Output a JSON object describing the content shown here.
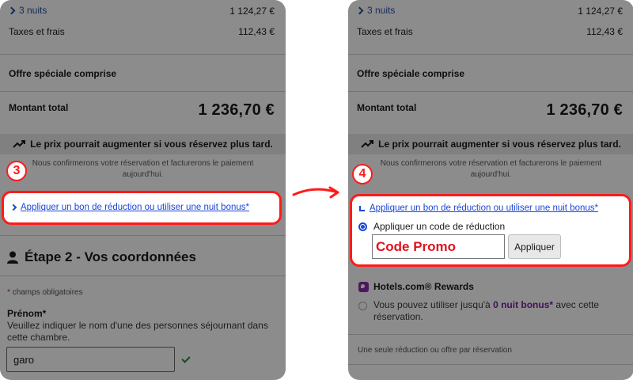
{
  "left": {
    "nights": "3 nuits",
    "nights_price": "1 124,27 €",
    "taxes_label": "Taxes et frais",
    "taxes_price": "112,43 €",
    "special_offer": "Offre spéciale comprise",
    "total_label": "Montant total",
    "total_amount": "1 236,70 €",
    "price_warning": "Le prix pourrait augmenter si vous réservez plus tard.",
    "confirm_line1": "Nous confirmerons votre réservation et facturerons le paiement",
    "confirm_line2": "aujourd'hui.",
    "badge": "3",
    "discount_link": "Appliquer un bon de réduction ou utiliser une nuit bonus*",
    "step_title": "Étape 2 - Vos coordonnées",
    "required_note": "champs obligatoires",
    "firstname_label": "Prénom*",
    "firstname_help_line1": "Veuillez indiquer le nom d'une des personnes séjournant dans",
    "firstname_help_line2": "cette chambre.",
    "firstname_value": "garo"
  },
  "right": {
    "nights": "3 nuits",
    "nights_price": "1 124,27 €",
    "taxes_label": "Taxes et frais",
    "taxes_price": "112,43 €",
    "special_offer": "Offre spéciale comprise",
    "total_label": "Montant total",
    "total_amount": "1 236,70 €",
    "price_warning": "Le prix pourrait augmenter si vous réservez plus tard.",
    "confirm_line1": "Nous confirmerons votre réservation et facturerons le paiement",
    "confirm_line2": "aujourd'hui.",
    "badge": "4",
    "discount_link": "Appliquer un bon de réduction ou utiliser une nuit bonus*",
    "code_option": "Appliquer un code de réduction",
    "promo_value": "Code Promo",
    "apply_button": "Appliquer",
    "rewards_title": "Hotels.com® Rewards",
    "rewards_text_part1": "Vous pouvez utiliser jusqu'à ",
    "rewards_text_bold": "0 nuit bonus*",
    "rewards_text_part2": " avec cette",
    "rewards_text_line2": "réservation.",
    "single_offer_note": "Une seule réduction ou offre par réservation"
  },
  "colors": {
    "highlight": "#ff1a1a",
    "link": "#1a46d8",
    "promo_text": "#e0121f",
    "rewards_brand": "#8a2ca8"
  },
  "icons": [
    "chevron-right-icon",
    "trending-up-icon",
    "person-icon",
    "checkmark-icon",
    "hotels-logo-icon",
    "arrow-right-icon"
  ]
}
